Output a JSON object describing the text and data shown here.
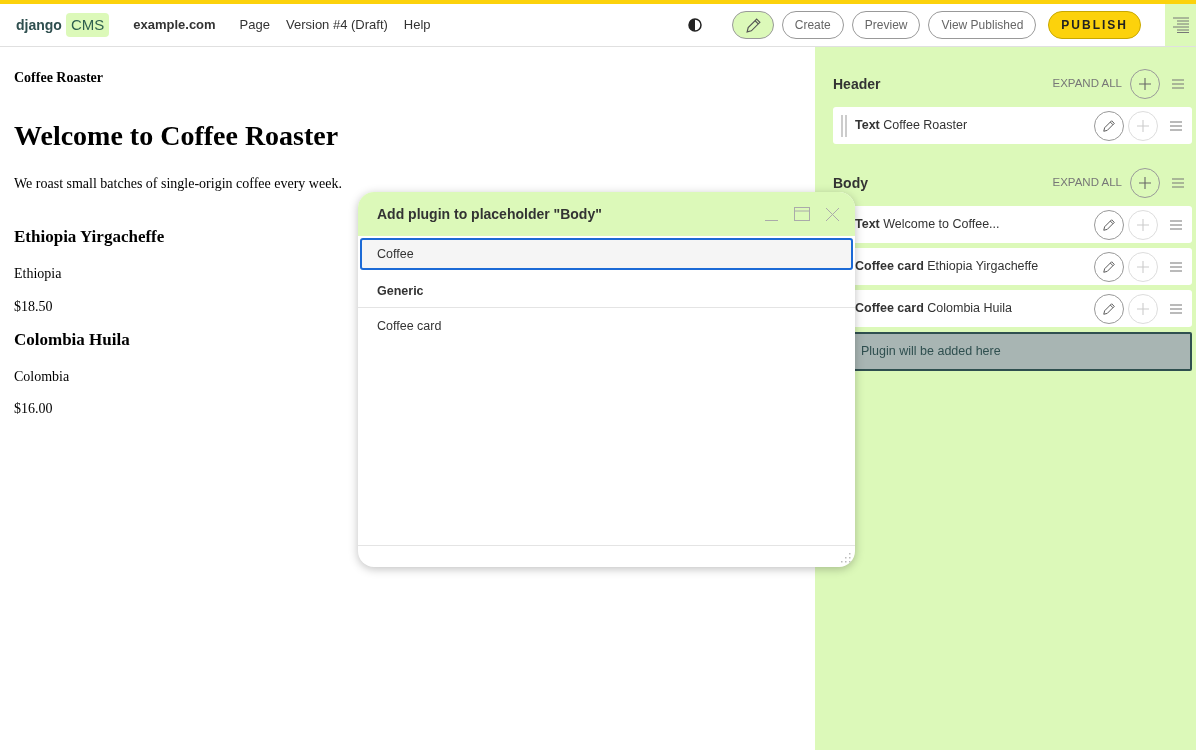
{
  "toolbar": {
    "logo": {
      "word": "django",
      "badge": "CMS"
    },
    "menu": [
      {
        "label": "example.com",
        "kind": "site"
      },
      {
        "label": "Page",
        "kind": "menu"
      },
      {
        "label": "Version #4 (Draft)",
        "kind": "menu"
      },
      {
        "label": "Help",
        "kind": "menu"
      }
    ],
    "edit_selected": true,
    "buttons": [
      {
        "label": "Create",
        "kind": "outline"
      },
      {
        "label": "Preview",
        "kind": "outline"
      },
      {
        "label": "View Published",
        "kind": "outline"
      },
      {
        "label": "PUBLISH",
        "kind": "primary"
      }
    ]
  },
  "page": {
    "site_title": "Coffee Roaster",
    "heading": "Welcome to Coffee Roaster",
    "intro": "We roast small batches of single-origin coffee every week.",
    "products": [
      {
        "name": "Ethiopia Yirgacheffe",
        "origin": "Ethiopia",
        "price": "$18.50"
      },
      {
        "name": "Colombia Huila",
        "origin": "Colombia",
        "price": "$16.00"
      }
    ]
  },
  "sidebar": {
    "placeholders": [
      {
        "name": "Header",
        "expand": "EXPAND ALL",
        "plugins": [
          {
            "type": "Text",
            "title": "Coffee Roaster"
          }
        ]
      },
      {
        "name": "Body",
        "expand": "EXPAND ALL",
        "plugins": [
          {
            "type": "Text",
            "title": "Welcome to Coffee..."
          },
          {
            "type": "Coffee card",
            "title": "Ethiopia Yirgacheffe"
          },
          {
            "type": "Coffee card",
            "title": "Colombia Huila"
          }
        ],
        "drop_hint": "Plugin will be added here"
      }
    ]
  },
  "modal": {
    "title": "Add plugin to placeholder \"Body\"",
    "search": {
      "value": "Coffee"
    },
    "groups": [
      {
        "heading": "Generic",
        "items": [
          "Coffee card"
        ]
      }
    ]
  }
}
